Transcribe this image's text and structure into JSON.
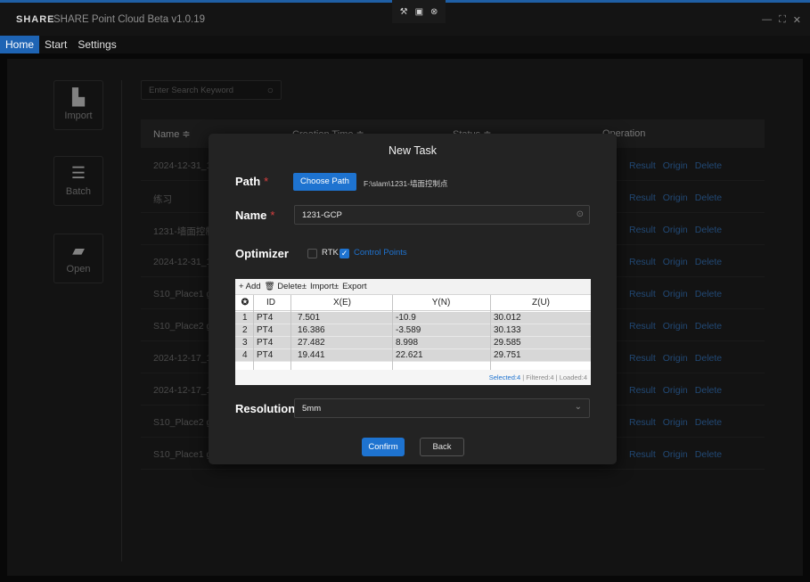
{
  "app": {
    "logo": "SHARE",
    "title": "SHARE Point Cloud Beta v1.0.19",
    "tray_icons": [
      "tool-icon",
      "image-icon",
      "close-circle-icon"
    ],
    "window_controls": [
      "minimize-icon",
      "maximize-icon",
      "close-icon"
    ]
  },
  "menu": {
    "items": [
      {
        "label": "Home",
        "active": true
      },
      {
        "label": "Start",
        "active": false
      },
      {
        "label": "Settings",
        "active": false
      }
    ]
  },
  "sidebar": {
    "buttons": [
      {
        "label": "Import",
        "icon": "file-icon"
      },
      {
        "label": "Batch",
        "icon": "batch-icon"
      },
      {
        "label": "Open",
        "icon": "folder-icon"
      }
    ]
  },
  "search": {
    "placeholder": "Enter Search Keyword"
  },
  "table": {
    "headers": {
      "name": "Name ≑",
      "creation_time": "Creation Time ≑",
      "status": "Status ≑",
      "operation": "Operation"
    },
    "rows": [
      {
        "name": "2024-12-31_1",
        "ops": [
          "Result",
          "Origin",
          "Delete"
        ]
      },
      {
        "name": "练习",
        "ops": [
          "Result",
          "Origin",
          "Delete"
        ]
      },
      {
        "name": "1231-墙面控制",
        "ops": [
          "Result",
          "Origin",
          "Delete"
        ]
      },
      {
        "name": "2024-12-31_1",
        "ops": [
          "Result",
          "Origin",
          "Delete"
        ]
      },
      {
        "name": "S10_Place1 gc",
        "ops": [
          "Result",
          "Origin",
          "Delete"
        ]
      },
      {
        "name": "S10_Place2 gc",
        "ops": [
          "Result",
          "Origin",
          "Delete"
        ]
      },
      {
        "name": "2024-12-17_1",
        "ops": [
          "Result",
          "Origin",
          "Delete"
        ]
      },
      {
        "name": "2024-12-17_1",
        "ops": [
          "Result",
          "Origin",
          "Delete"
        ]
      },
      {
        "name": "S10_Place2 gc",
        "ops": [
          "Result",
          "Origin",
          "Delete"
        ]
      },
      {
        "name": "S10_Place1 gc",
        "ops": [
          "Result",
          "Origin",
          "Delete"
        ]
      }
    ]
  },
  "modal": {
    "title": "New Task",
    "path_label": "Path",
    "required_mark": "*",
    "choose_path_label": "Choose Path",
    "path_value": "F:\\slam\\1231-墙面控制点",
    "name_label": "Name",
    "name_value": "1231-GCP",
    "optimizer_label": "Optimizer",
    "rtk_label": "RTK",
    "rtk_checked": false,
    "control_points_label": "Control Points",
    "control_points_checked": true,
    "grid": {
      "toolbar": [
        "+ Add",
        "🗑 Delete±",
        "Import±",
        "Export"
      ],
      "headers": {
        "sel": "✪",
        "id": "ID",
        "x": "X(E)",
        "y": "Y(N)",
        "z": "Z(U)"
      },
      "rows": [
        {
          "idx": "1",
          "id": "PT4",
          "x": "7.501",
          "y": "-10.9",
          "z": "30.012"
        },
        {
          "idx": "2",
          "id": "PT4",
          "x": "16.386",
          "y": "-3.589",
          "z": "30.133"
        },
        {
          "idx": "3",
          "id": "PT4",
          "x": "27.482",
          "y": "8.998",
          "z": "29.585"
        },
        {
          "idx": "4",
          "id": "PT4",
          "x": "19.441",
          "y": "22.621",
          "z": "29.751"
        }
      ],
      "footer": {
        "selected": "Selected:4",
        "filtered": "Filtered:4",
        "loaded": "Loaded:4",
        "sep": "|"
      }
    },
    "resolution_label": "Resolution",
    "resolution_value": "5mm",
    "confirm_label": "Confirm",
    "back_label": "Back"
  },
  "colors": {
    "accent": "#1e73d0",
    "link": "#3a7dc9",
    "required": "#d94040"
  }
}
